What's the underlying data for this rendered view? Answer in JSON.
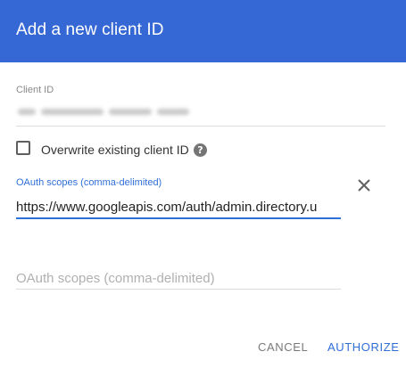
{
  "dialog": {
    "title": "Add a new client ID"
  },
  "client_id": {
    "label": "Client ID",
    "value_redacted": true
  },
  "overwrite": {
    "label": "Overwrite existing client ID",
    "checked": false,
    "help_icon": "help-circle-icon",
    "help_glyph": "?"
  },
  "scopes_field_1": {
    "label": "OAuth scopes (comma-delimited)",
    "value": "https://www.googleapis.com/auth/admin.directory.u",
    "remove_icon": "close-icon"
  },
  "scopes_field_2": {
    "placeholder": "OAuth scopes (comma-delimited)",
    "value": ""
  },
  "actions": {
    "cancel_label": "CANCEL",
    "authorize_label": "AUTHORIZE"
  },
  "colors": {
    "header": "#3568d4",
    "accent": "#2f6fd8",
    "muted_text": "#8a8a8a"
  }
}
